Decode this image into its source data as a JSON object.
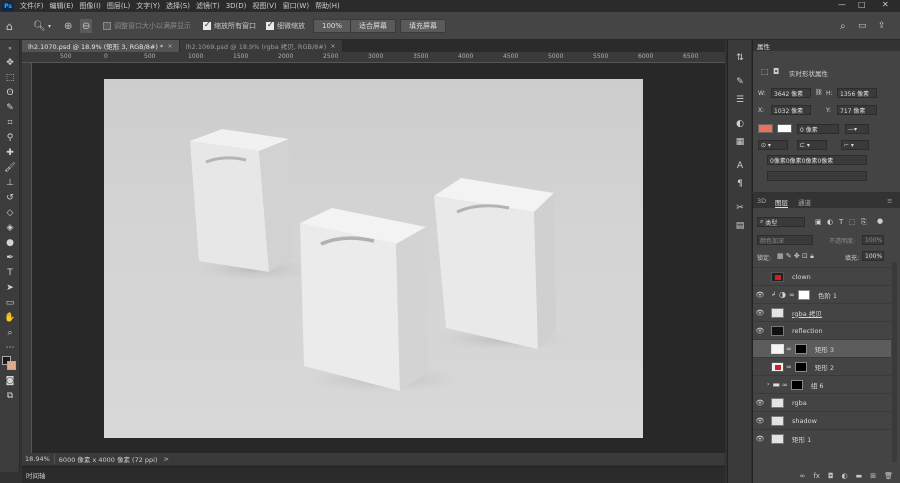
{
  "app": {
    "logo_text": "Ps",
    "menus": [
      "文件(F)",
      "编辑(E)",
      "图像(I)",
      "图层(L)",
      "文字(Y)",
      "选择(S)",
      "滤镜(T)",
      "3D(D)",
      "视图(V)",
      "窗口(W)",
      "帮助(H)"
    ],
    "window_controls": {
      "minimize": "—",
      "maximize": "□",
      "close": "✕"
    }
  },
  "options_bar": {
    "resize_windows_label": "调整窗口大小以满屏显示",
    "resize_windows_checked": false,
    "zoom_all_label": "缩放所有窗口",
    "zoom_all_checked": true,
    "scrubby_zoom_label": "细微缩放",
    "scrubby_zoom_checked": true,
    "zoom_value": "100%",
    "fit_screen_label": "适合屏幕",
    "fill_screen_label": "填充屏幕"
  },
  "tabs": [
    {
      "label": "lh2.1070.psd @ 18.9% (矩形 3, RGB/8#) *",
      "close": "×",
      "active": true
    },
    {
      "label": "lh2.1069.psd @ 18.9% (rgba 拷贝, RGB/8#)",
      "close": "×",
      "active": false
    }
  ],
  "ruler": {
    "top_labels": [
      "500",
      "0",
      "500",
      "1000",
      "1500",
      "2000",
      "2500",
      "3000",
      "3500",
      "4000",
      "4500",
      "5000",
      "5500",
      "6000",
      "6500"
    ]
  },
  "status": {
    "zoom": "18.94%",
    "doc_size": "6000 像素 x 4000 像素 (72 ppi)",
    "arrow": ">"
  },
  "timeline": {
    "label": "时间轴"
  },
  "properties": {
    "title": "属性",
    "shape_title": "实时形状属性",
    "w_label": "W:",
    "w_value": "3642 像素",
    "h_label": "H:",
    "h_value": "1356 像素",
    "x_label": "X:",
    "x_value": "1032 像素",
    "y_label": "Y:",
    "y_value": "717 像素",
    "fill_color": "#e8735a",
    "stroke_width": "0 像素",
    "radius_value": "0像素0像素0像素0像素"
  },
  "layers_panel": {
    "tabs": [
      "3D",
      "图层",
      "通道"
    ],
    "kind_filter": "类型",
    "blend_mode": "颜色加深",
    "opacity_label": "不透明度:",
    "opacity_value": "100%",
    "lock_label": "锁定:",
    "fill_label": "填充:",
    "fill_value": "100%",
    "layers": [
      {
        "name": "clown",
        "visible": false,
        "thumb": "red",
        "selected": false
      },
      {
        "name": "色阶 1",
        "visible": true,
        "thumb": "adjust",
        "selected": false
      },
      {
        "name": "rgba 拷贝",
        "visible": true,
        "thumb": "light",
        "selected": false
      },
      {
        "name": "reflection",
        "visible": true,
        "thumb": "dark",
        "selected": false
      },
      {
        "name": "矩形 3",
        "visible": false,
        "thumb": "shape",
        "selected": true
      },
      {
        "name": "矩形 2",
        "visible": false,
        "thumb": "shape-red",
        "selected": false
      },
      {
        "name": "组 6",
        "visible": false,
        "thumb": "group",
        "selected": false
      },
      {
        "name": "rgba",
        "visible": true,
        "thumb": "light",
        "selected": false
      },
      {
        "name": "shadow",
        "visible": true,
        "thumb": "light",
        "selected": false
      },
      {
        "name": "矩形 1",
        "visible": true,
        "thumb": "light",
        "selected": false
      }
    ],
    "bottom_icons": [
      "link-icon",
      "fx-icon",
      "mask-icon",
      "adjustment-icon",
      "folder-icon",
      "new-layer-icon",
      "trash-icon"
    ]
  }
}
